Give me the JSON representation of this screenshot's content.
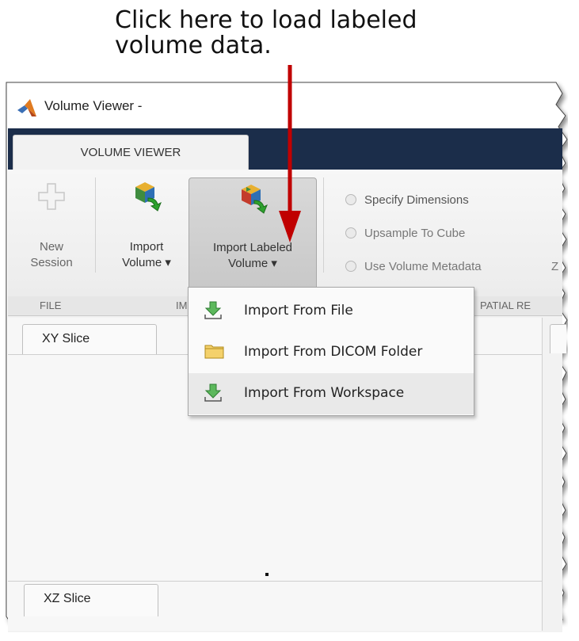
{
  "callout": {
    "line1": "Click here to load labeled",
    "line2": "volume data."
  },
  "window": {
    "title": "Volume Viewer -",
    "tab": "VOLUME VIEWER"
  },
  "ribbon": {
    "new_session": {
      "line1": "New",
      "line2": "Session"
    },
    "import_volume": {
      "line1": "Import",
      "line2": "Volume ▾"
    },
    "import_labeled_volume": {
      "line1": "Import Labeled",
      "line2": "Volume ▾"
    },
    "radios": [
      {
        "label": "Specify Dimensions"
      },
      {
        "label": "Upsample To Cube"
      },
      {
        "label": "Use Volume Metadata"
      }
    ],
    "partial_z": "Z",
    "group_labels": {
      "file": "FILE",
      "import": "IM",
      "spatial": "PATIAL RE"
    }
  },
  "dropdown_menu": {
    "items": [
      {
        "label": "Import From File",
        "icon": "green-download-arrow-icon"
      },
      {
        "label": "Import From DICOM Folder",
        "icon": "folder-icon"
      },
      {
        "label": "Import From Workspace",
        "icon": "green-download-arrow-icon"
      }
    ]
  },
  "slices": {
    "xy": "XY Slice",
    "xz": "XZ Slice"
  },
  "colors": {
    "tabstrip": "#1b2d4a",
    "arrow": "#c00000",
    "menu_hover": "#e9e9e9"
  }
}
